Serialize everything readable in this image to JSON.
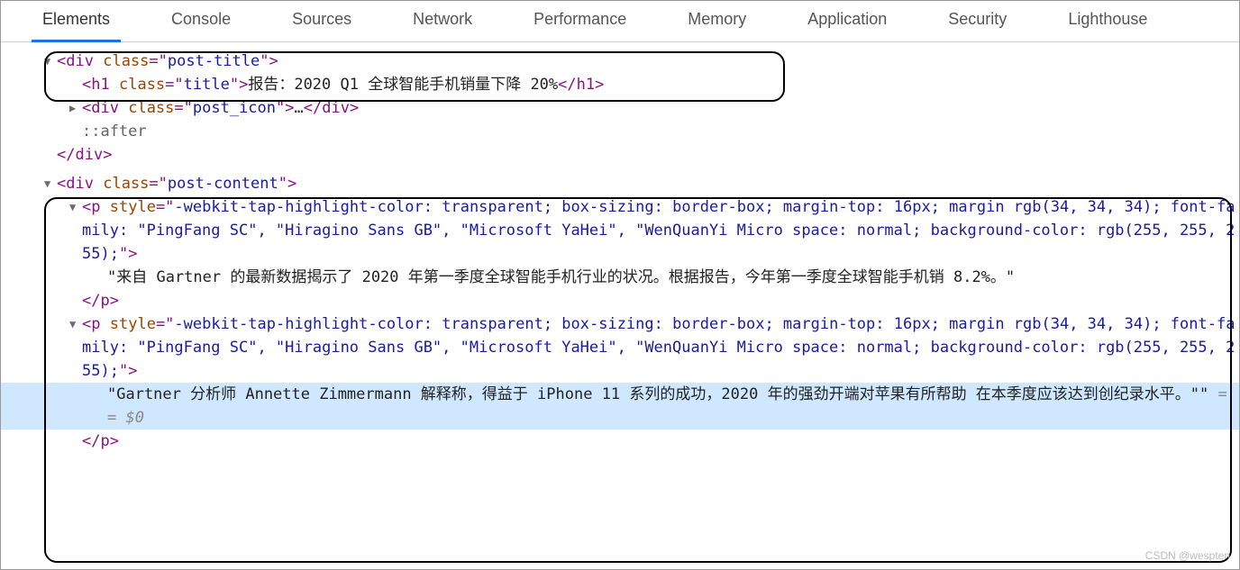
{
  "tabs": {
    "elements": "Elements",
    "console": "Console",
    "sources": "Sources",
    "network": "Network",
    "performance": "Performance",
    "memory": "Memory",
    "application": "Application",
    "security": "Security",
    "lighthouse": "Lighthouse"
  },
  "dom": {
    "postTitle": {
      "open": "<div class=\"post-title\">",
      "h1": "<h1 class=\"title\">报告：2020 Q1 全球智能手机销量下降 20%</h1>",
      "postIconOpen": "<div class=\"post_icon\">",
      "ellipsis": "…",
      "postIconClose": "</div>",
      "after": "::after",
      "close": "</div>"
    },
    "postContent": {
      "open": "<div class=\"post-content\">",
      "pStyle": "<p style=\"-webkit-tap-highlight-color: transparent; box-sizing: border-box; margin-top: 16px; margin rgb(34, 34, 34); font-family: \"PingFang SC\", \"Hiragino Sans GB\", \"Microsoft YaHei\", \"WenQuanYi Micro  space: normal; background-color: rgb(255, 255, 255);\">",
      "text1": "\"来自 Gartner 的最新数据揭示了 2020 年第一季度全球智能手机行业的状况。根据报告，今年第一季度全球智能手机销 8.2%。\"",
      "pClose": "</p>",
      "text2": "\"Gartner 分析师 Annette Zimmermann 解释称，得益于 iPhone 11 系列的成功，2020 年的强劲开端对苹果有所帮助 在本季度应该达到创纪录水平。\"\"",
      "selMark": " == $0"
    }
  },
  "watermark": "CSDN @wespten"
}
